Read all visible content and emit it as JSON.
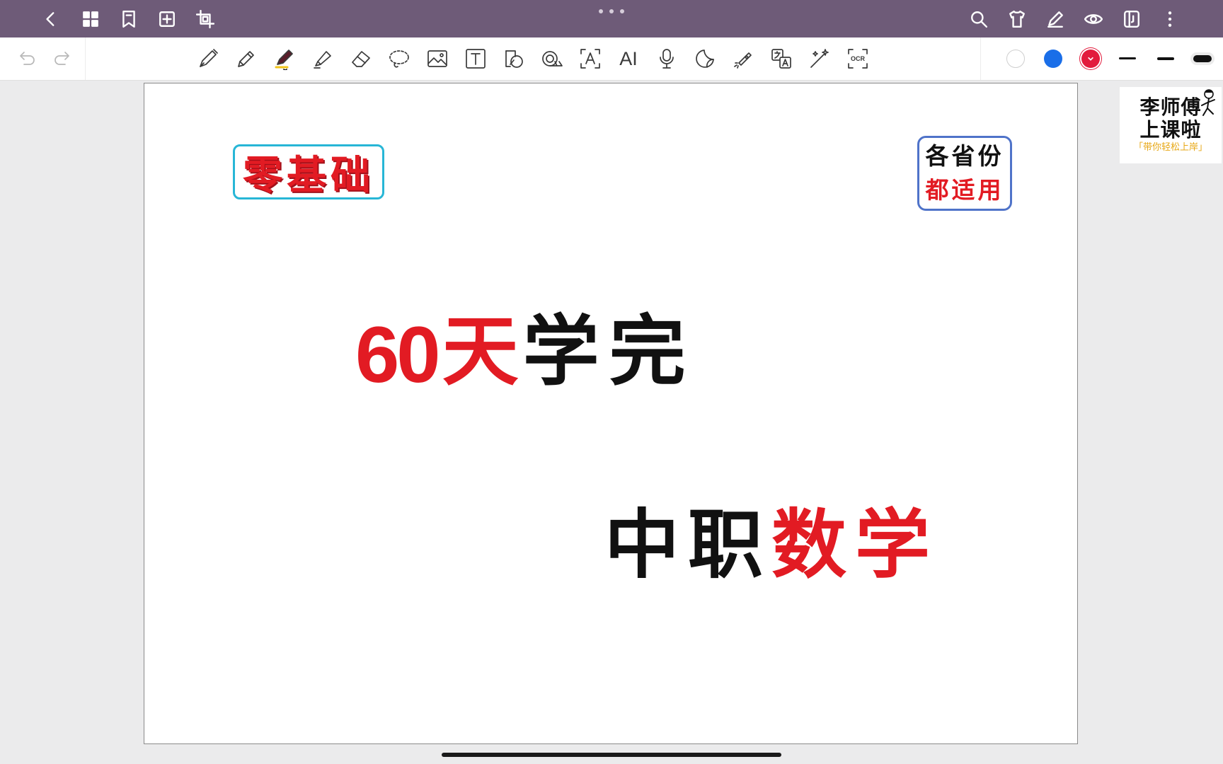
{
  "top_bar": {
    "color": "#6e5b78",
    "left_icons": [
      "back-icon",
      "grid-icon",
      "bookmark-icon",
      "add-page-icon",
      "crop-icon"
    ],
    "right_icons": [
      "search-icon",
      "shirt-icon",
      "pen-edit-icon",
      "eye-icon",
      "split-view-icon",
      "more-vertical-icon"
    ]
  },
  "toolbar": {
    "tools": [
      "fountain-pen",
      "pencil",
      "marker-pen",
      "highlighter",
      "eraser",
      "lasso",
      "image",
      "text-box",
      "shape",
      "tape",
      "text-recognition",
      "ai-text",
      "microphone",
      "sticker",
      "laser-pointer",
      "translate",
      "magic-wand",
      "ocr"
    ],
    "ai_label": "AI",
    "ocr_label": "OCR",
    "selected_tool": "marker-pen",
    "colors": [
      "#ffffff",
      "#1a6ee8",
      "#e21b3c"
    ],
    "selected_color": "#e21b3c"
  },
  "canvas": {
    "badge_left": "零基础",
    "badge_right_line1": "各省份",
    "badge_right_line2": "都适用",
    "headline_number": "60",
    "headline_red": "天",
    "headline_black": "学完",
    "subline_black": "中职",
    "subline_red": "数学"
  },
  "watermark": {
    "line1": "李师傅",
    "line2": "上课啦",
    "line3": "「带你轻松上岸」"
  }
}
